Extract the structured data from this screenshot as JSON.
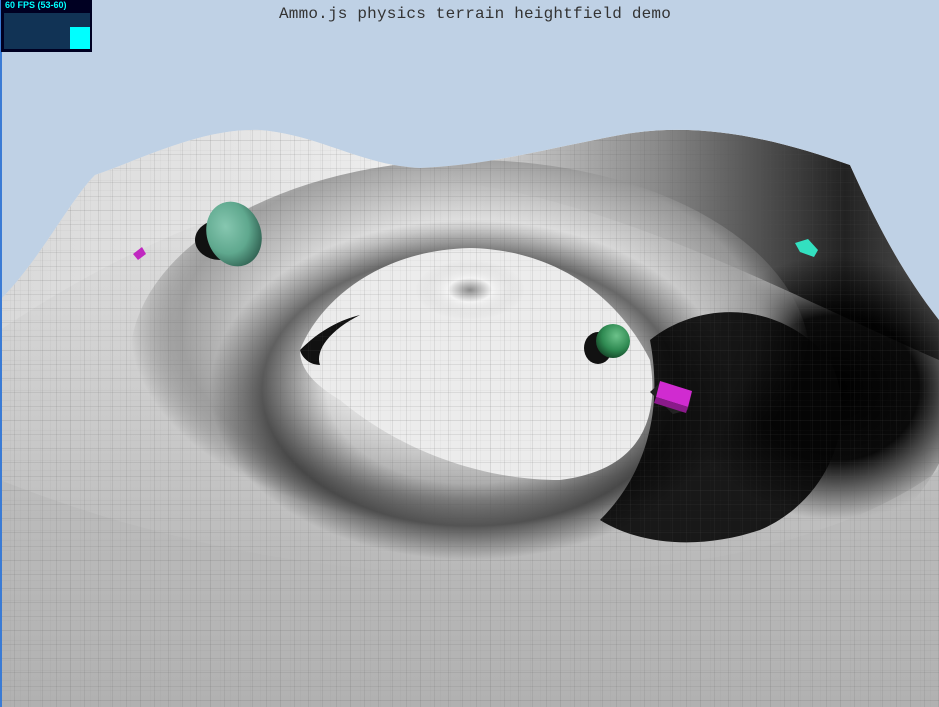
{
  "title": "Ammo.js physics terrain heightfield demo",
  "stats": {
    "fps_text": "60 FPS (53-60)",
    "fps_fraction": 0.62
  },
  "colors": {
    "sky": "#bfd1e5",
    "terrain_light": "#f2f2f2",
    "terrain_dark": "#000000",
    "grid_line": "#555555",
    "sphere_teal": "#5fa88e",
    "sphere_green": "#2f8a52",
    "box_magenta": "#d02bd0",
    "cyan_object": "#33e0c0",
    "stats_text": "#00ffff",
    "stats_bg": "#000022"
  },
  "objects": [
    {
      "name": "teal-sphere",
      "kind": "sphere"
    },
    {
      "name": "green-sphere",
      "kind": "sphere"
    },
    {
      "name": "magenta-box",
      "kind": "box"
    },
    {
      "name": "magenta-box-far",
      "kind": "box"
    },
    {
      "name": "cyan-object",
      "kind": "cylinder"
    }
  ]
}
